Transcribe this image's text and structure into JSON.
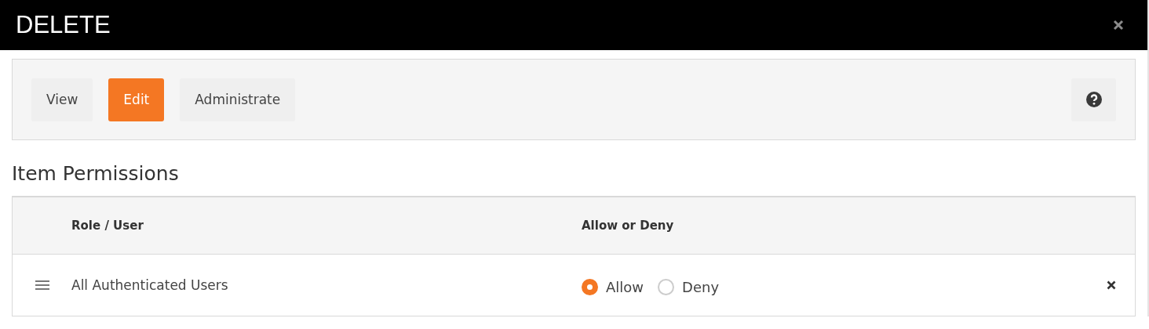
{
  "window": {
    "title": "DELETE"
  },
  "tabs": [
    {
      "label": "View",
      "selected": false
    },
    {
      "label": "Edit",
      "selected": true
    },
    {
      "label": "Administrate",
      "selected": false
    }
  ],
  "section_title": "Item Permissions",
  "table": {
    "columns": [
      "Role / User",
      "Allow or Deny"
    ],
    "rows": [
      {
        "name": "All Authenticated Users",
        "options": [
          {
            "label": "Allow",
            "selected": true
          },
          {
            "label": "Deny",
            "selected": false
          }
        ]
      }
    ]
  }
}
